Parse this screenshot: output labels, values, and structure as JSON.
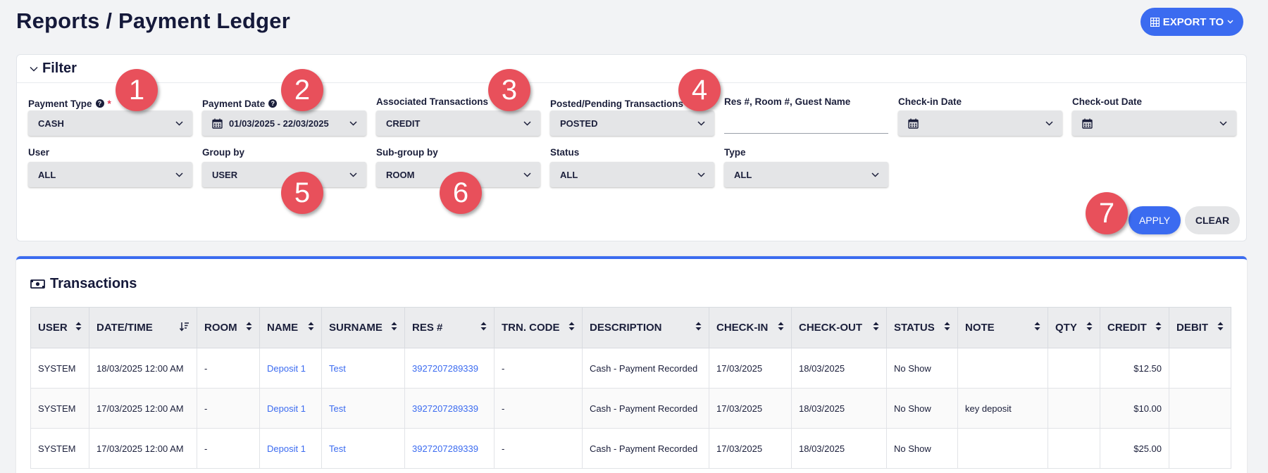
{
  "page": {
    "title": "Reports  / Payment Ledger",
    "export_label": "EXPORT TO"
  },
  "filter": {
    "title": "Filter",
    "payment_type": {
      "label": "Payment Type",
      "value": "CASH"
    },
    "payment_date": {
      "label": "Payment Date",
      "value": "01/03/2025 - 22/03/2025"
    },
    "associated": {
      "label": "Associated Transactions",
      "value": "CREDIT"
    },
    "posted": {
      "label": "Posted/Pending Transactions",
      "value": "POSTED"
    },
    "res_search": {
      "label": "Res #, Room #, Guest Name",
      "value": ""
    },
    "checkin": {
      "label": "Check-in Date"
    },
    "checkout": {
      "label": "Check-out Date"
    },
    "user": {
      "label": "User",
      "value": "ALL"
    },
    "group_by": {
      "label": "Group by",
      "value": "USER"
    },
    "subgroup_by": {
      "label": "Sub-group by",
      "value": "ROOM"
    },
    "status": {
      "label": "Status",
      "value": "ALL"
    },
    "type": {
      "label": "Type",
      "value": "ALL"
    },
    "apply_label": "APPLY",
    "clear_label": "CLEAR"
  },
  "badges": [
    "1",
    "2",
    "3",
    "4",
    "5",
    "6",
    "7"
  ],
  "transactions": {
    "title": "Transactions",
    "columns": [
      "USER",
      "DATE/TIME",
      "ROOM",
      "NAME",
      "SURNAME",
      "RES #",
      "TRN. CODE",
      "DESCRIPTION",
      "CHECK-IN",
      "CHECK-OUT",
      "STATUS",
      "NOTE",
      "QTY",
      "CREDIT",
      "DEBIT"
    ],
    "rows": [
      [
        "SYSTEM",
        "18/03/2025 12:00 AM",
        "-",
        "Deposit 1",
        "Test",
        "3927207289339",
        "-",
        "Cash - Payment Recorded",
        "17/03/2025",
        "18/03/2025",
        "No Show",
        "",
        "",
        "$12.50",
        ""
      ],
      [
        "SYSTEM",
        "17/03/2025 12:00 AM",
        "-",
        "Deposit 1",
        "Test",
        "3927207289339",
        "-",
        "Cash - Payment Recorded",
        "17/03/2025",
        "18/03/2025",
        "No Show",
        "key deposit",
        "",
        "$10.00",
        ""
      ],
      [
        "SYSTEM",
        "17/03/2025 12:00 AM",
        "-",
        "Deposit 1",
        "Test",
        "3927207289339",
        "-",
        "Cash - Payment Recorded",
        "17/03/2025",
        "18/03/2025",
        "No Show",
        "",
        "",
        "$25.00",
        ""
      ]
    ]
  },
  "colors": {
    "accent": "#3b6bf0",
    "badge": "#e8505b"
  }
}
